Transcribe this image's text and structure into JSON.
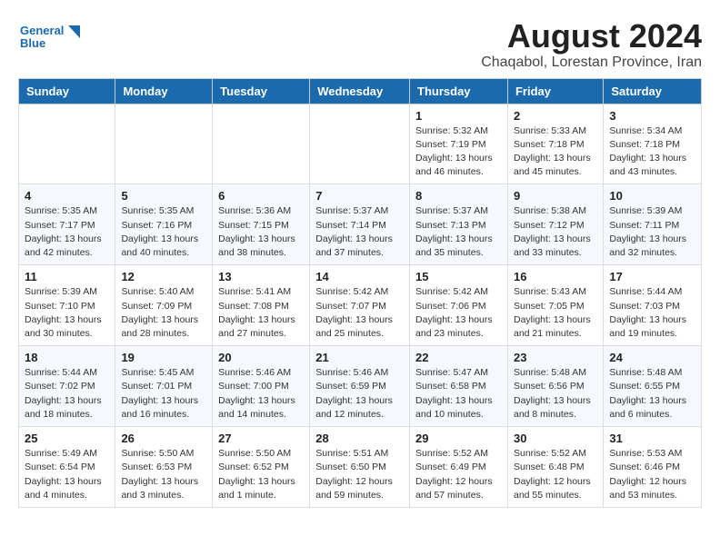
{
  "header": {
    "month_year": "August 2024",
    "location": "Chaqabol, Lorestan Province, Iran",
    "logo_text_1": "General",
    "logo_text_2": "Blue"
  },
  "weekdays": [
    "Sunday",
    "Monday",
    "Tuesday",
    "Wednesday",
    "Thursday",
    "Friday",
    "Saturday"
  ],
  "weeks": [
    [
      {
        "day": "",
        "info": ""
      },
      {
        "day": "",
        "info": ""
      },
      {
        "day": "",
        "info": ""
      },
      {
        "day": "",
        "info": ""
      },
      {
        "day": "1",
        "info": "Sunrise: 5:32 AM\nSunset: 7:19 PM\nDaylight: 13 hours\nand 46 minutes."
      },
      {
        "day": "2",
        "info": "Sunrise: 5:33 AM\nSunset: 7:18 PM\nDaylight: 13 hours\nand 45 minutes."
      },
      {
        "day": "3",
        "info": "Sunrise: 5:34 AM\nSunset: 7:18 PM\nDaylight: 13 hours\nand 43 minutes."
      }
    ],
    [
      {
        "day": "4",
        "info": "Sunrise: 5:35 AM\nSunset: 7:17 PM\nDaylight: 13 hours\nand 42 minutes."
      },
      {
        "day": "5",
        "info": "Sunrise: 5:35 AM\nSunset: 7:16 PM\nDaylight: 13 hours\nand 40 minutes."
      },
      {
        "day": "6",
        "info": "Sunrise: 5:36 AM\nSunset: 7:15 PM\nDaylight: 13 hours\nand 38 minutes."
      },
      {
        "day": "7",
        "info": "Sunrise: 5:37 AM\nSunset: 7:14 PM\nDaylight: 13 hours\nand 37 minutes."
      },
      {
        "day": "8",
        "info": "Sunrise: 5:37 AM\nSunset: 7:13 PM\nDaylight: 13 hours\nand 35 minutes."
      },
      {
        "day": "9",
        "info": "Sunrise: 5:38 AM\nSunset: 7:12 PM\nDaylight: 13 hours\nand 33 minutes."
      },
      {
        "day": "10",
        "info": "Sunrise: 5:39 AM\nSunset: 7:11 PM\nDaylight: 13 hours\nand 32 minutes."
      }
    ],
    [
      {
        "day": "11",
        "info": "Sunrise: 5:39 AM\nSunset: 7:10 PM\nDaylight: 13 hours\nand 30 minutes."
      },
      {
        "day": "12",
        "info": "Sunrise: 5:40 AM\nSunset: 7:09 PM\nDaylight: 13 hours\nand 28 minutes."
      },
      {
        "day": "13",
        "info": "Sunrise: 5:41 AM\nSunset: 7:08 PM\nDaylight: 13 hours\nand 27 minutes."
      },
      {
        "day": "14",
        "info": "Sunrise: 5:42 AM\nSunset: 7:07 PM\nDaylight: 13 hours\nand 25 minutes."
      },
      {
        "day": "15",
        "info": "Sunrise: 5:42 AM\nSunset: 7:06 PM\nDaylight: 13 hours\nand 23 minutes."
      },
      {
        "day": "16",
        "info": "Sunrise: 5:43 AM\nSunset: 7:05 PM\nDaylight: 13 hours\nand 21 minutes."
      },
      {
        "day": "17",
        "info": "Sunrise: 5:44 AM\nSunset: 7:03 PM\nDaylight: 13 hours\nand 19 minutes."
      }
    ],
    [
      {
        "day": "18",
        "info": "Sunrise: 5:44 AM\nSunset: 7:02 PM\nDaylight: 13 hours\nand 18 minutes."
      },
      {
        "day": "19",
        "info": "Sunrise: 5:45 AM\nSunset: 7:01 PM\nDaylight: 13 hours\nand 16 minutes."
      },
      {
        "day": "20",
        "info": "Sunrise: 5:46 AM\nSunset: 7:00 PM\nDaylight: 13 hours\nand 14 minutes."
      },
      {
        "day": "21",
        "info": "Sunrise: 5:46 AM\nSunset: 6:59 PM\nDaylight: 13 hours\nand 12 minutes."
      },
      {
        "day": "22",
        "info": "Sunrise: 5:47 AM\nSunset: 6:58 PM\nDaylight: 13 hours\nand 10 minutes."
      },
      {
        "day": "23",
        "info": "Sunrise: 5:48 AM\nSunset: 6:56 PM\nDaylight: 13 hours\nand 8 minutes."
      },
      {
        "day": "24",
        "info": "Sunrise: 5:48 AM\nSunset: 6:55 PM\nDaylight: 13 hours\nand 6 minutes."
      }
    ],
    [
      {
        "day": "25",
        "info": "Sunrise: 5:49 AM\nSunset: 6:54 PM\nDaylight: 13 hours\nand 4 minutes."
      },
      {
        "day": "26",
        "info": "Sunrise: 5:50 AM\nSunset: 6:53 PM\nDaylight: 13 hours\nand 3 minutes."
      },
      {
        "day": "27",
        "info": "Sunrise: 5:50 AM\nSunset: 6:52 PM\nDaylight: 13 hours\nand 1 minute."
      },
      {
        "day": "28",
        "info": "Sunrise: 5:51 AM\nSunset: 6:50 PM\nDaylight: 12 hours\nand 59 minutes."
      },
      {
        "day": "29",
        "info": "Sunrise: 5:52 AM\nSunset: 6:49 PM\nDaylight: 12 hours\nand 57 minutes."
      },
      {
        "day": "30",
        "info": "Sunrise: 5:52 AM\nSunset: 6:48 PM\nDaylight: 12 hours\nand 55 minutes."
      },
      {
        "day": "31",
        "info": "Sunrise: 5:53 AM\nSunset: 6:46 PM\nDaylight: 12 hours\nand 53 minutes."
      }
    ]
  ]
}
